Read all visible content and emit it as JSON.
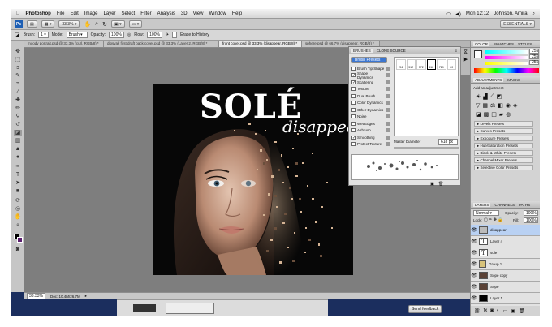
{
  "menubar": {
    "apple": "",
    "app": "Photoshop",
    "items": [
      "File",
      "Edit",
      "Image",
      "Layer",
      "Select",
      "Filter",
      "Analysis",
      "3D",
      "View",
      "Window",
      "Help"
    ],
    "time": "Mon 12:12",
    "user": "Johnson, Amira"
  },
  "appbar": {
    "zoom": "33.3%",
    "workspace": "ESSENTIALS ▾"
  },
  "options": {
    "brush_label": "Brush:",
    "brush_size": "1",
    "mode_label": "Mode:",
    "mode_value": "Brush",
    "opacity_label": "Opacity:",
    "opacity_value": "100%",
    "flow_label": "Flow:",
    "flow_value": "100%",
    "erase_history": "Erase to History"
  },
  "doc_tabs": [
    "moody portrait.psd @ 33.3% (curl, RGB/8) *",
    "dipsyak first draft back cover.psd @ 33.3% (Layer 2, RGB/8) *",
    "front cover.psd @ 33.3% (disappear, RGB/8) *",
    "sphere.psd @ 66.7% (disappear, RGB/8) *"
  ],
  "artwork": {
    "title": "SOLÉ",
    "subtitle": "disappear"
  },
  "status": {
    "zoom": "33.33%",
    "doc": "Doc: 10.4M/26.7M",
    "feedback": "Send feedback"
  },
  "brushes_panel": {
    "tabs": [
      "BRUSHES",
      "CLONE SOURCE"
    ],
    "presets_button": "Brush Presets",
    "options": [
      {
        "label": "Brush Tip Shape",
        "checked": false
      },
      {
        "label": "Shape Dynamics",
        "checked": true
      },
      {
        "label": "Scattering",
        "checked": true
      },
      {
        "label": "Texture",
        "checked": false
      },
      {
        "label": "Dual Brush",
        "checked": false
      },
      {
        "label": "Color Dynamics",
        "checked": false
      },
      {
        "label": "Other Dynamics",
        "checked": false
      },
      {
        "label": "Noise",
        "checked": false
      },
      {
        "label": "Wet Edges",
        "checked": false
      },
      {
        "label": "Airbrush",
        "checked": false
      },
      {
        "label": "Smoothing",
        "checked": true
      },
      {
        "label": "Protect Texture",
        "checked": false
      }
    ],
    "tip_sizes": [
      "211",
      "512",
      "572",
      "618",
      "729",
      "60"
    ],
    "master_diameter_label": "Master Diameter",
    "master_diameter_value": "618 px"
  },
  "color_panel": {
    "tabs": [
      "COLOR",
      "SWATCHES",
      "STYLES"
    ],
    "r": "255",
    "g": "255",
    "b": "255"
  },
  "adjustments_panel": {
    "tabs": [
      "ADJUSTMENTS",
      "MASKS"
    ],
    "title": "Add an adjustment",
    "presets": [
      "Levels Presets",
      "Curves Presets",
      "Exposure Presets",
      "Hue/Saturation Presets",
      "Black & White Presets",
      "Channel Mixer Presets",
      "Selective Color Presets"
    ]
  },
  "layers_panel": {
    "tabs": [
      "LAYERS",
      "CHANNELS",
      "PATHS"
    ],
    "blend": "Normal",
    "opacity_label": "Opacity:",
    "opacity_value": "100%",
    "lock_label": "Lock:",
    "fill_label": "Fill:",
    "fill_value": "100%",
    "layers": [
      {
        "name": "disappear",
        "kind": "smart",
        "selected": true
      },
      {
        "name": "Layer 4",
        "kind": "text",
        "selected": false
      },
      {
        "name": "sole",
        "kind": "text",
        "selected": false
      },
      {
        "name": "Group 1",
        "kind": "group",
        "selected": false
      },
      {
        "name": "Sope copy",
        "kind": "photo",
        "selected": false
      },
      {
        "name": "Sope",
        "kind": "photo",
        "selected": false
      },
      {
        "name": "Layer 1",
        "kind": "black",
        "selected": false
      }
    ]
  }
}
